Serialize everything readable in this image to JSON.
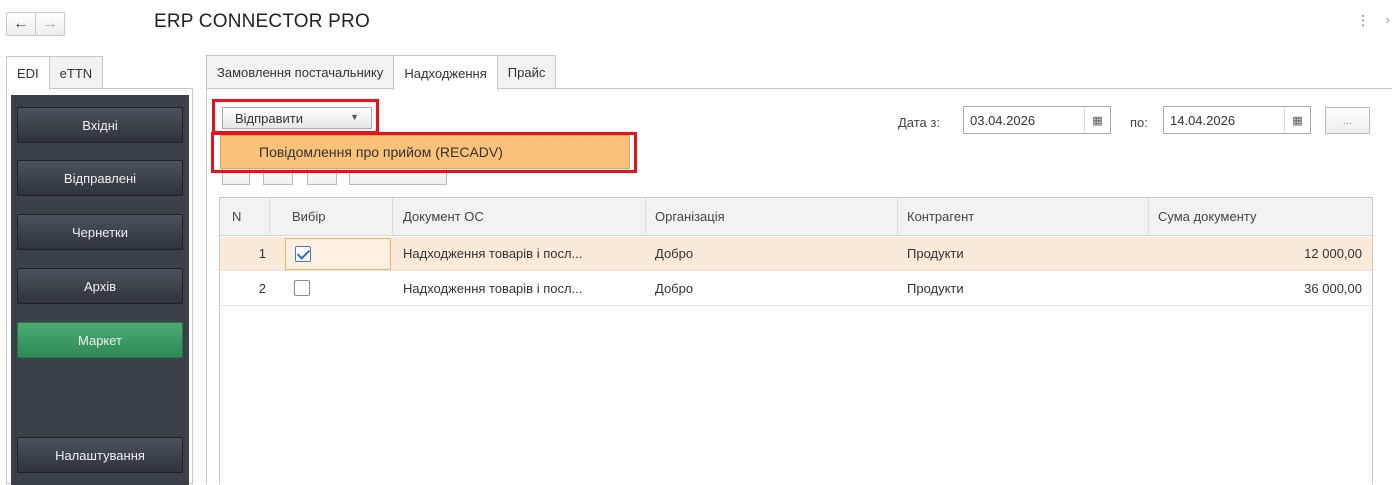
{
  "header": {
    "title": "ERP CONNECTOR PRO",
    "back_icon": "←",
    "forward_icon": "→",
    "more_icon": "⋮",
    "chevron_icon": "›"
  },
  "left_tabs": [
    "EDI",
    "eTTN"
  ],
  "sidebar": {
    "items": [
      {
        "label": "Вхідні"
      },
      {
        "label": "Відправлені"
      },
      {
        "label": "Чернетки"
      },
      {
        "label": "Архів"
      },
      {
        "label": "Маркет"
      },
      {
        "label": "Налаштування"
      }
    ],
    "accent_color": "#3a9a62"
  },
  "main_tabs": [
    "Замовлення постачальнику",
    "Надходження",
    "Прайс"
  ],
  "toolbar": {
    "send_label": "Відправити",
    "dropdown_item": "Повідомлення про прийом (RECADV)",
    "dots_label": "..."
  },
  "dates": {
    "from_label": "Дата з:",
    "from_value": "03.04.2026",
    "to_label": "по:",
    "to_value": "14.04.2026"
  },
  "table": {
    "columns": [
      "N",
      "Вибір",
      "Документ ОС",
      "Організація",
      "Контрагент",
      "Сума документу"
    ],
    "rows": [
      {
        "n": "1",
        "checked": true,
        "doc": "Надходження товарів і посл...",
        "org": "Добро",
        "counterparty": "Продукти",
        "sum": "12 000,00"
      },
      {
        "n": "2",
        "checked": false,
        "doc": "Надходження товарів і посл...",
        "org": "Добро",
        "counterparty": "Продукти",
        "sum": "36 000,00"
      }
    ]
  },
  "highlight_color": "#e8111c"
}
